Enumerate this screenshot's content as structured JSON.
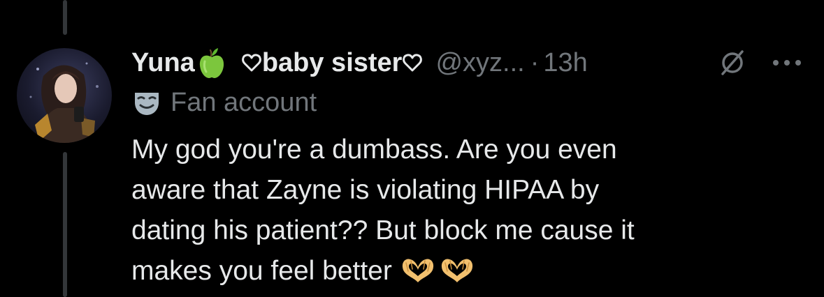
{
  "tweet": {
    "display_name": "Yuna",
    "display_name_emoji": "green-apple-icon",
    "display_name_suffix": "baby sister",
    "suffix_decoration": "outline-heart-icon",
    "handle": "@xyz...",
    "separator": "·",
    "timestamp": "13h",
    "label_icon": "performing-arts-mask-icon",
    "label_text": "Fan account",
    "text_lines": [
      "My god you're a dumbass. Are you even",
      "aware that Zayne is violating HIPAA by",
      "dating his patient?? But block me cause it",
      "makes you feel better"
    ],
    "trailing_emojis": [
      "heart-hands-icon",
      "heart-hands-icon"
    ]
  },
  "actions": {
    "mute_icon": "no-entry-icon",
    "more_icon": "more-dots-icon"
  },
  "colors": {
    "background": "#000000",
    "primary_text": "#e7e9ea",
    "secondary_text": "#71767b",
    "thread_line": "#333639"
  }
}
